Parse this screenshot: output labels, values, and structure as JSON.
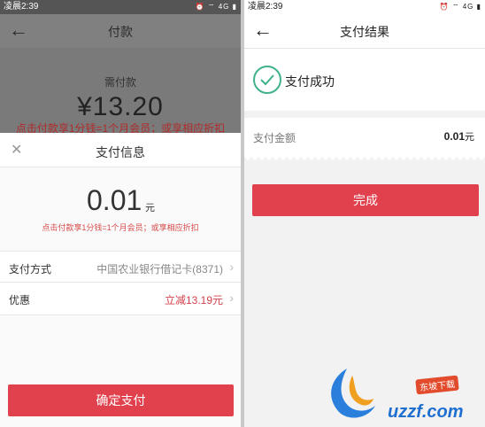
{
  "left": {
    "status": {
      "time": "凌晨2:39",
      "icons": "⏰ ⌔ 4G ▮"
    },
    "header": {
      "back": "←",
      "title": "付款"
    },
    "background": {
      "label": "需付款",
      "amount": "¥13.20",
      "promo": "点击付款享1分钱=1个月会员；或享相应折扣"
    },
    "sheet": {
      "close": "✕",
      "title": "支付信息",
      "amount": "0.01",
      "unit": "元",
      "promo": "点击付款享1分钱=1个月会员；或享相应折扣",
      "method_label": "支付方式",
      "method_value": "中国农业银行借记卡(8371)",
      "discount_label": "优惠",
      "discount_value": "立减13.19元",
      "confirm": "确定支付"
    }
  },
  "right": {
    "status": {
      "time": "凌晨2:39",
      "icons": "⏰ ⌔ 4G ▮"
    },
    "header": {
      "back": "←",
      "title": "支付结果"
    },
    "result": {
      "text": "支付成功"
    },
    "amount": {
      "label": "支付金额",
      "value": "0.01",
      "unit": "元"
    },
    "done": "完成"
  },
  "watermark": {
    "brand": "uzzf.com",
    "sub": "东坡下载"
  },
  "colors": {
    "accent": "#e0414d",
    "success": "#3fb18d"
  }
}
